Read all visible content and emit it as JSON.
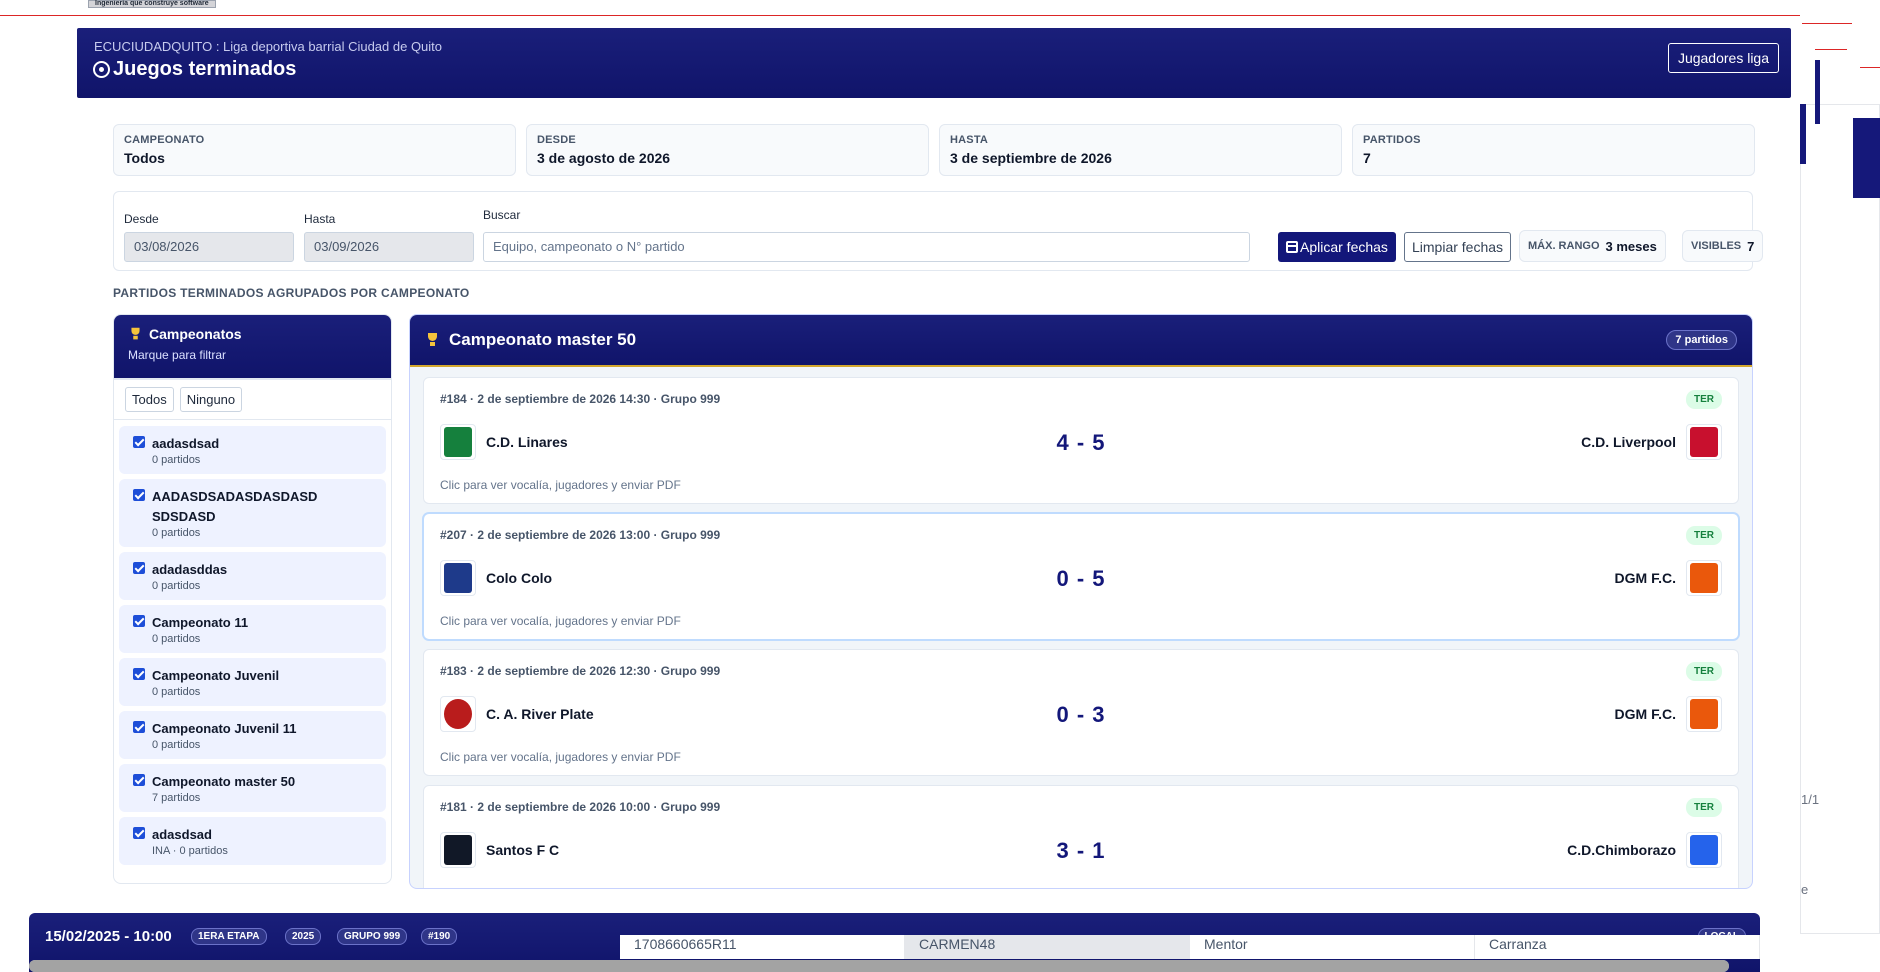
{
  "background": {
    "top_badge": "Ingeniería que construye software",
    "side_text": "1/1",
    "side_text_2": "e"
  },
  "header": {
    "org": "ECUCIUDADQUITO : Liga deportiva barrial Ciudad de Quito",
    "title": "Juegos terminados",
    "players_button": "Jugadores liga"
  },
  "summary": [
    {
      "label": "Campeonato",
      "value": "Todos"
    },
    {
      "label": "Desde",
      "value": "3 de agosto de 2026"
    },
    {
      "label": "Hasta",
      "value": "3 de septiembre de 2026"
    },
    {
      "label": "Partidos",
      "value": "7"
    }
  ],
  "filters": {
    "from_label": "Desde",
    "from_value": "03/08/2026",
    "to_label": "Hasta",
    "to_value": "03/09/2026",
    "search_label": "Buscar",
    "search_placeholder": "Equipo, campeonato o N° partido",
    "apply_label": "Aplicar fechas",
    "clear_label": "Limpiar fechas",
    "max_range_label": "Máx. rango",
    "max_range_value": "3 meses",
    "visible_label": "Visibles",
    "visible_value": "7"
  },
  "section_title": "Partidos terminados agrupados por campeonato",
  "sidebar": {
    "title": "Campeonatos",
    "subtitle": "Marque para filtrar",
    "all_label": "Todos",
    "none_label": "Ninguno",
    "items": [
      {
        "name": "aadasdsad",
        "count": "0 partidos"
      },
      {
        "name": "AADASDSADASDASDASD SDSDASD",
        "count": "0 partidos"
      },
      {
        "name": "adadasddas",
        "count": "0 partidos"
      },
      {
        "name": "Campeonato 11",
        "count": "0 partidos"
      },
      {
        "name": "Campeonato Juvenil",
        "count": "0 partidos"
      },
      {
        "name": "Campeonato Juvenil 11",
        "count": "0 partidos"
      },
      {
        "name": "Campeonato master 50",
        "count": "7 partidos"
      },
      {
        "name": "adasdsad",
        "count": "INA · 0 partidos"
      }
    ]
  },
  "group": {
    "title": "Campeonato master 50",
    "count": "7 partidos",
    "matches": [
      {
        "meta": "#184 · 2 de septiembre de 2026 14:30 · Grupo 999",
        "status": "TER",
        "home": "C.D. Linares",
        "score": "4 - 5",
        "away": "C.D. Liverpool",
        "hint": "Clic para ver vocalía, jugadores y enviar PDF",
        "home_color": "#15803d",
        "away_color": "#c8102e"
      },
      {
        "meta": "#207 · 2 de septiembre de 2026 13:00 · Grupo 999",
        "status": "TER",
        "home": "Colo Colo",
        "score": "0 - 5",
        "away": "DGM F.C.",
        "hint": "Clic para ver vocalía, jugadores y enviar PDF",
        "home_color": "#1e3a8a",
        "away_color": "#ea580c"
      },
      {
        "meta": "#183 · 2 de septiembre de 2026 12:30 · Grupo 999",
        "status": "TER",
        "home": "C. A. River Plate",
        "score": "0 - 3",
        "away": "DGM F.C.",
        "hint": "Clic para ver vocalía, jugadores y enviar PDF",
        "home_color": "#b91c1c",
        "away_color": "#ea580c"
      },
      {
        "meta": "#181 · 2 de septiembre de 2026 10:00 · Grupo 999",
        "status": "TER",
        "home": "Santos F C",
        "score": "3 - 1",
        "away": "C.D.Chimborazo",
        "hint": "",
        "home_color": "#111827",
        "away_color": "#2563eb"
      }
    ]
  },
  "bottom": {
    "datetime": "15/02/2025 - 10:00",
    "tags": [
      "1ERA ETAPA",
      "2025",
      "GRUPO 999",
      "#190"
    ],
    "local": "LOCAL",
    "cells": [
      "1708660665R11",
      "CARMEN48",
      "Mentor",
      "Carranza"
    ]
  }
}
